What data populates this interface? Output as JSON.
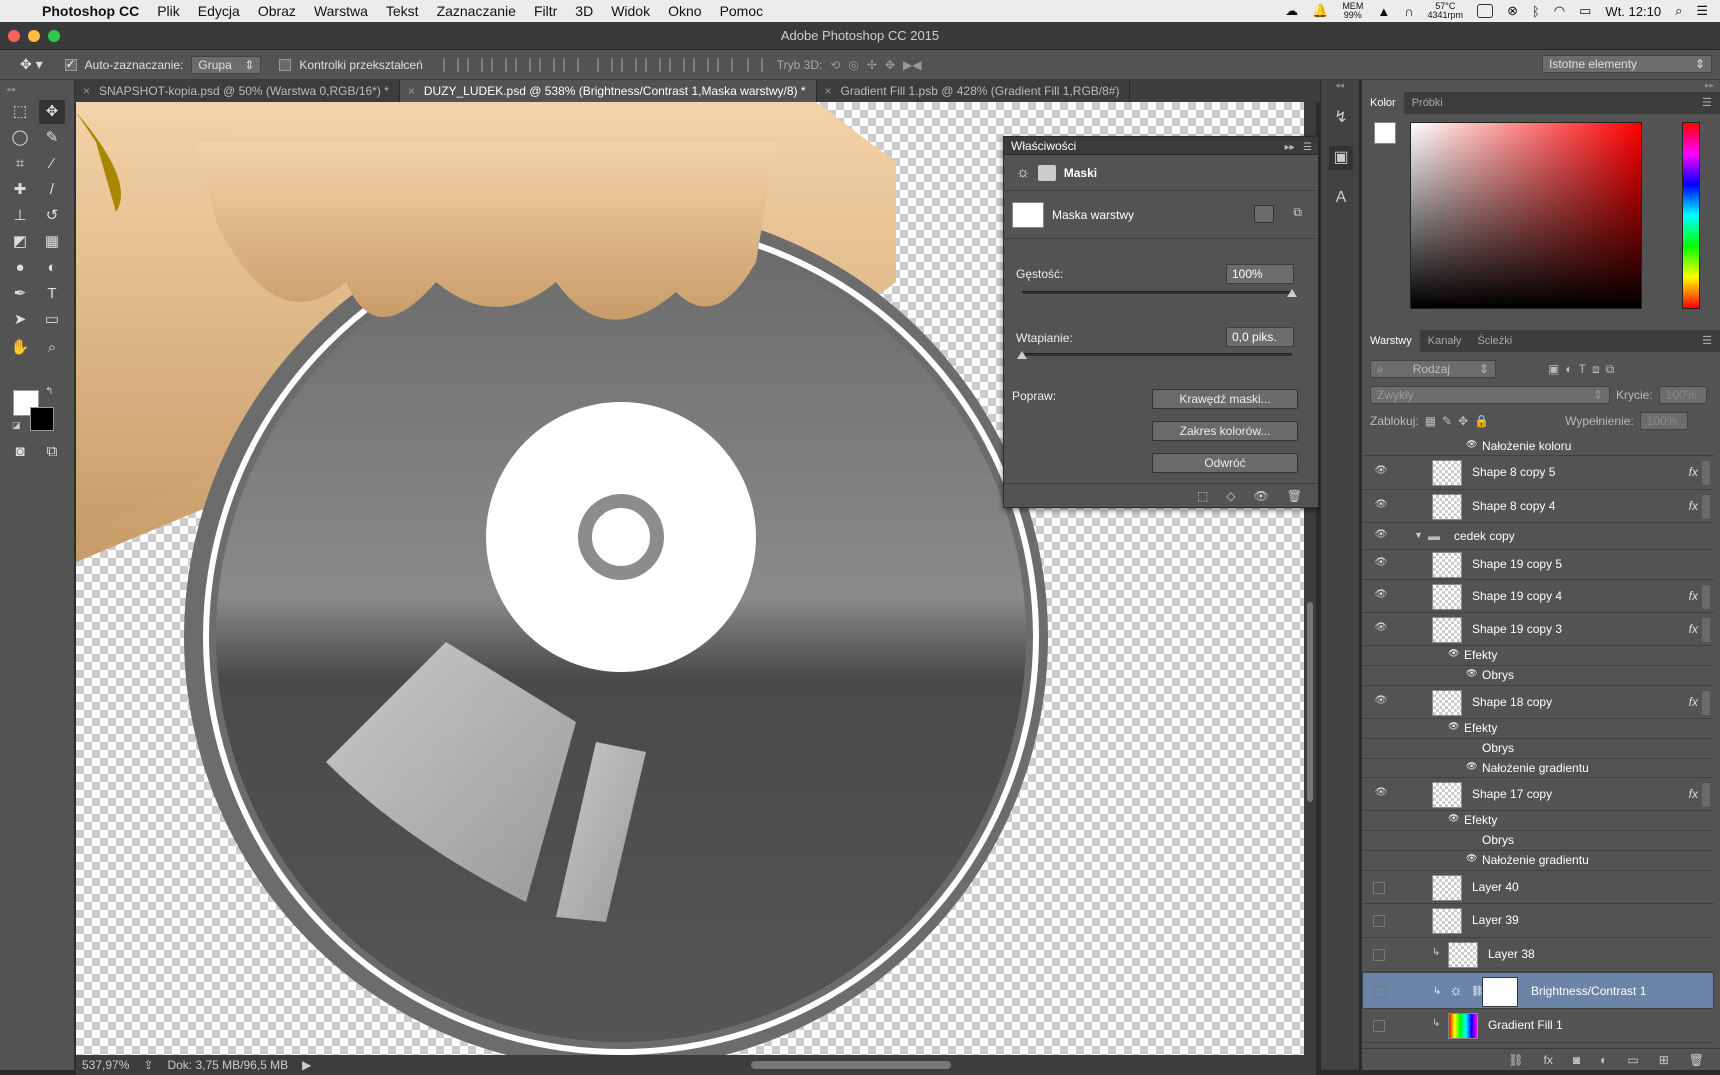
{
  "menubar": {
    "app": "Photoshop CC",
    "items": [
      "Plik",
      "Edycja",
      "Obraz",
      "Warstwa",
      "Tekst",
      "Zaznaczanie",
      "Filtr",
      "3D",
      "Widok",
      "Okno",
      "Pomoc"
    ],
    "mem_label": "MEM",
    "mem_value": "99%",
    "temp": "57°C",
    "rpm": "4341rpm",
    "clock": "Wt. 12:10"
  },
  "window": {
    "title": "Adobe Photoshop CC 2015"
  },
  "options": {
    "auto_select_label": "Auto-zaznaczanie:",
    "auto_select_value": "Grupa",
    "transform_controls_label": "Kontrolki przekształceń",
    "mode3d_label": "Tryb 3D:",
    "workspace": "Istotne elementy"
  },
  "tabs": [
    {
      "label": "SNAPSHOT-kopia.psd @ 50% (Warstwa 0,RGB/16*) *",
      "active": false
    },
    {
      "label": "DUZY_LUDEK.psd @ 538% (Brightness/Contrast 1,Maska warstwy/8) *",
      "active": true
    },
    {
      "label": "Gradient Fill 1.psb @ 428% (Gradient Fill 1,RGB/8#)",
      "active": false
    }
  ],
  "status": {
    "zoom": "537,97%",
    "doc": "Dok: 3,75 MB/96,5 MB"
  },
  "properties": {
    "title": "Właściwości",
    "section": "Maski",
    "mask_label": "Maska warstwy",
    "density_label": "Gęstość:",
    "density_value": "100%",
    "density": 100,
    "feather_label": "Wtapianie:",
    "feather_value": "0,0 piks.",
    "feather": 0,
    "refine_label": "Popraw:",
    "btn_edge": "Krawędź maski...",
    "btn_color_range": "Zakres kolorów...",
    "btn_invert": "Odwróć"
  },
  "color_panel": {
    "tabs": [
      "Kolor",
      "Próbki"
    ]
  },
  "layers_panel": {
    "tabs": [
      "Warstwy",
      "Kanały",
      "Ścieżki"
    ],
    "filter": "Rodzaj",
    "blend": "Zwykły",
    "opacity_label": "Krycie:",
    "opacity_value": "100%",
    "lock_label": "Zablokuj:",
    "fill_label": "Wypełnienie:",
    "fill_value": "100%",
    "rows": [
      {
        "type": "effect",
        "label": "Nałożenie koloru"
      },
      {
        "type": "layer",
        "label": "Shape 8 copy 5",
        "fx": "fx"
      },
      {
        "type": "layer",
        "label": "Shape 8 copy 4",
        "fx": "fx"
      },
      {
        "type": "group",
        "label": "cedek copy"
      },
      {
        "type": "layer",
        "label": "Shape 19 copy 5"
      },
      {
        "type": "layer",
        "label": "Shape 19 copy 4",
        "fx": "fx"
      },
      {
        "type": "layer",
        "label": "Shape 19 copy 3",
        "fx": "fx"
      },
      {
        "type": "effects",
        "label": "Efekty"
      },
      {
        "type": "effect",
        "label": "Obrys"
      },
      {
        "type": "layer",
        "label": "Shape 18 copy",
        "fx": "fx"
      },
      {
        "type": "effects",
        "label": "Efekty"
      },
      {
        "type": "effect",
        "label": "Obrys"
      },
      {
        "type": "effect",
        "label": "Nałożenie gradientu"
      },
      {
        "type": "layer",
        "label": "Shape 17 copy",
        "fx": "fx"
      },
      {
        "type": "effects",
        "label": "Efekty"
      },
      {
        "type": "effect",
        "label": "Obrys"
      },
      {
        "type": "effect",
        "label": "Nałożenie gradientu"
      },
      {
        "type": "layer",
        "label": "Layer 40"
      },
      {
        "type": "layer",
        "label": "Layer 39"
      },
      {
        "type": "layer",
        "label": "Layer 38"
      },
      {
        "type": "adjust",
        "label": "Brightness/Contrast 1"
      },
      {
        "type": "layer",
        "label": "Gradient Fill 1"
      }
    ]
  },
  "colors": {
    "selected_row": "#6b84a8",
    "ui_bg": "#535353"
  }
}
